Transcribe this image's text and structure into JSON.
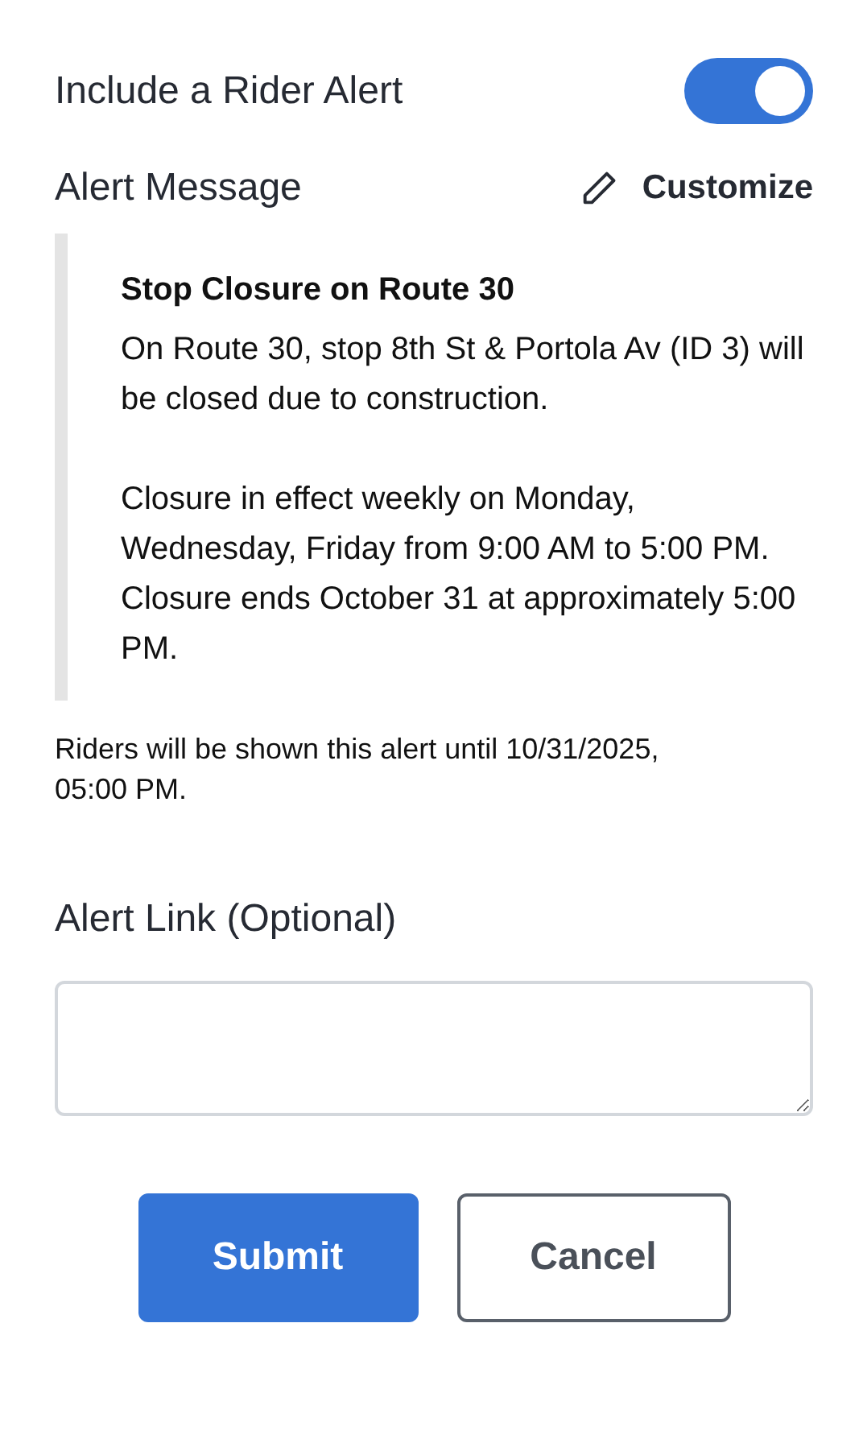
{
  "rider_alert": {
    "label": "Include a Rider Alert",
    "on": true
  },
  "alert_message": {
    "label": "Alert Message",
    "customize_label": "Customize",
    "title": "Stop Closure on Route 30",
    "paragraphs": [
      "On Route 30, stop 8th St & Portola Av (ID 3) will be closed due to construction.",
      "Closure in effect weekly on Monday, Wednesday, Friday from 9:00 AM to 5:00 PM. Closure ends October 31 at approximately 5:00 PM."
    ]
  },
  "notice": "Riders will be shown this alert until 10/31/2025, 05:00 PM.",
  "alert_link": {
    "label": "Alert Link (Optional)"
  },
  "buttons": [
    {
      "label": "Submit",
      "kind": "primary"
    },
    {
      "label": "Cancel",
      "kind": "secondary"
    }
  ]
}
